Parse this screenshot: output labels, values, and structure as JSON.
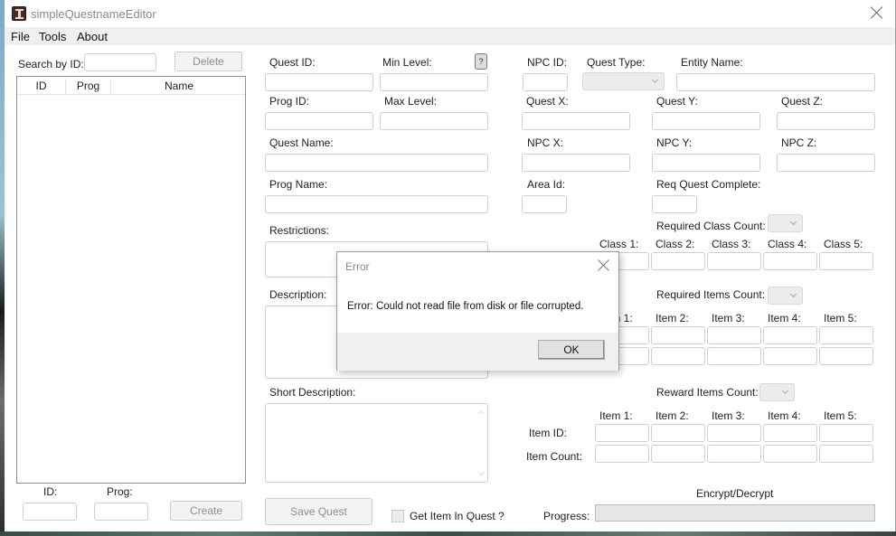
{
  "window": {
    "title": "simpleQuestnameEditor",
    "icon": "app-icon"
  },
  "menu": [
    "File",
    "Tools",
    "About"
  ],
  "left_panel": {
    "search_label": "Search by ID:",
    "search_value": "",
    "delete_label": "Delete",
    "columns": [
      "ID",
      "Prog",
      "Name"
    ],
    "rows": [],
    "id_label": "ID:",
    "prog_label": "Prog:",
    "id_value": "",
    "prog_value": "",
    "create_label": "Create"
  },
  "form": {
    "quest_id": {
      "label": "Quest ID:",
      "value": ""
    },
    "min_level": {
      "label": "Min Level:",
      "value": ""
    },
    "help_label": "?",
    "prog_id": {
      "label": "Prog ID:",
      "value": ""
    },
    "max_level": {
      "label": "Max Level:",
      "value": ""
    },
    "quest_name": {
      "label": "Quest Name:",
      "value": ""
    },
    "prog_name": {
      "label": "Prog Name:",
      "value": ""
    },
    "restrictions": {
      "label": "Restrictions:",
      "value": ""
    },
    "description": {
      "label": "Description:",
      "value": ""
    },
    "short_description": {
      "label": "Short Description:",
      "value": ""
    },
    "save_label": "Save Quest",
    "get_item_label": "Get Item In Quest ?",
    "get_item_checked": false,
    "npc_id": {
      "label": "NPC ID:",
      "value": ""
    },
    "quest_type": {
      "label": "Quest Type:",
      "value": ""
    },
    "entity_name": {
      "label": "Entity Name:",
      "value": ""
    },
    "quest_x": {
      "label": "Quest X:",
      "value": ""
    },
    "quest_y": {
      "label": "Quest Y:",
      "value": ""
    },
    "quest_z": {
      "label": "Quest Z:",
      "value": ""
    },
    "npc_x": {
      "label": "NPC X:",
      "value": ""
    },
    "npc_y": {
      "label": "NPC Y:",
      "value": ""
    },
    "npc_z": {
      "label": "NPC Z:",
      "value": ""
    },
    "area_id": {
      "label": "Area Id:",
      "value": ""
    },
    "req_quest": {
      "label": "Req Quest Complete:",
      "value": ""
    },
    "req_class_count": {
      "label": "Required Class Count:",
      "value": ""
    },
    "classes": [
      "Class 1:",
      "Class 2:",
      "Class 3:",
      "Class 4:",
      "Class 5:"
    ],
    "req_items_count": {
      "label": "Required Items Count:",
      "value": ""
    },
    "req_items": [
      "Item 1:",
      "Item 2:",
      "Item 3:",
      "Item 4:",
      "Item 5:"
    ],
    "reward_items_count": {
      "label": "Reward Items Count:",
      "value": ""
    },
    "reward_items": [
      "Item 1:",
      "Item 2:",
      "Item 3:",
      "Item 4:",
      "Item 5:"
    ],
    "item_id_label": "Item ID:",
    "item_count_label": "Item Count:",
    "encrypt_label": "Encrypt/Decrypt",
    "progress_label": "Progress:",
    "progress_value": 0
  },
  "dialog": {
    "title": "Error",
    "message": "Error: Could not read file from disk or file corrupted.",
    "ok_label": "OK"
  }
}
